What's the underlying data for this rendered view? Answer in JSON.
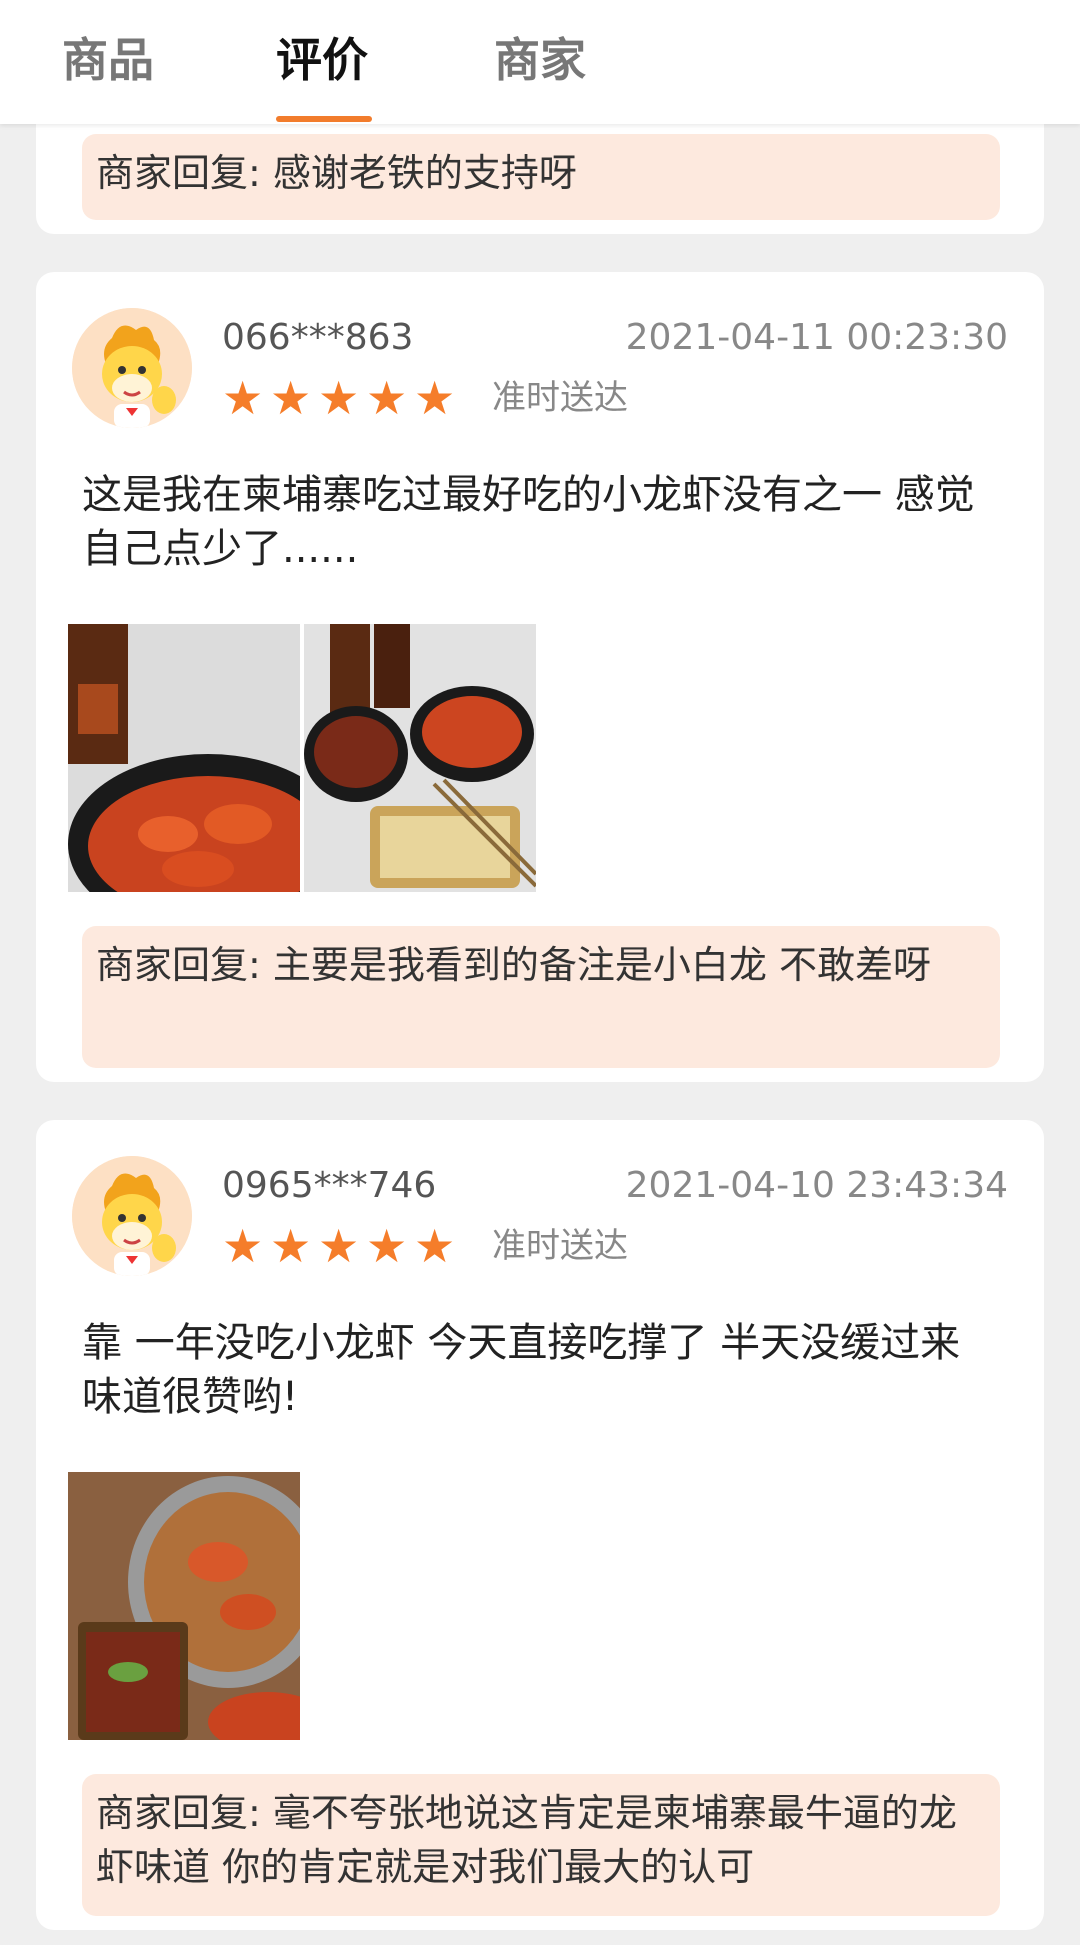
{
  "tabs": [
    {
      "label": "商品"
    },
    {
      "label": "评价"
    },
    {
      "label": "商家"
    }
  ],
  "reviews": [
    {
      "reply": "商家回复: 感谢老铁的支持呀"
    },
    {
      "user": "066***863",
      "time": "2021-04-11 00:23:30",
      "rating": 5,
      "tag": "准时送达",
      "text": "这是我在柬埔寨吃过最好吃的小龙虾没有之一 感觉自己点少了......",
      "reply": "商家回复: 主要是我看到的备注是小白龙 不敢差呀"
    },
    {
      "user": "0965***746",
      "time": "2021-04-10 23:43:34",
      "rating": 5,
      "tag": "准时送达",
      "text": "靠 一年没吃小龙虾 今天直接吃撑了 半天没缓过来 味道很赞哟!",
      "reply": "商家回复: 毫不夸张地说这肯定是柬埔寨最牛逼的龙虾味道 你的肯定就是对我们最大的认可"
    }
  ],
  "icons": {
    "star": "star-icon",
    "avatar": "horse-mascot-avatar"
  },
  "colors": {
    "accent": "#f27c2c",
    "reply_bg": "#fde9de"
  }
}
